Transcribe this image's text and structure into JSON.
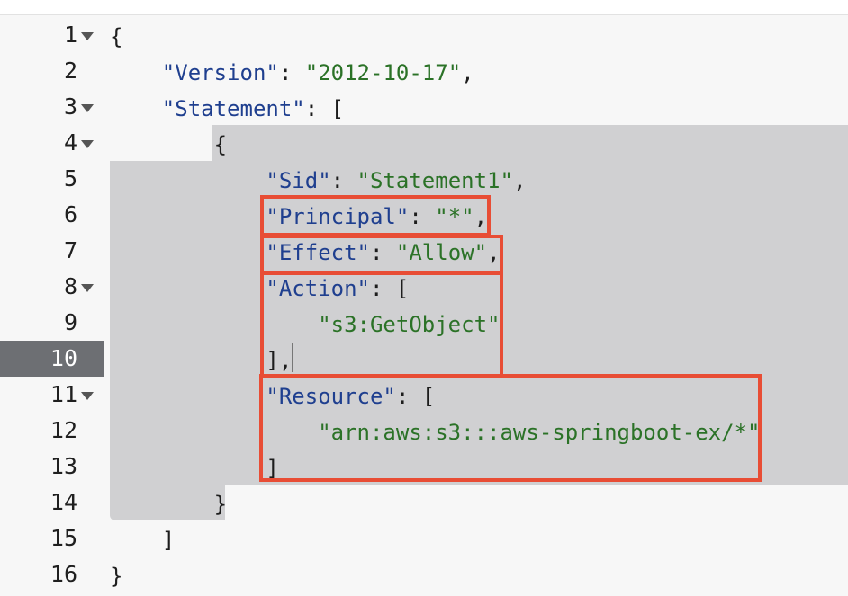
{
  "editor": {
    "active_line": "10",
    "lines": [
      {
        "number": "1",
        "foldable": true,
        "indent": "",
        "parts": {
          "p1": "{"
        }
      },
      {
        "number": "2",
        "foldable": false,
        "indent": "    ",
        "parts": {
          "k": "\"Version\"",
          "p1": ": ",
          "s": "\"2012-10-17\"",
          "p2": ","
        }
      },
      {
        "number": "3",
        "foldable": true,
        "indent": "    ",
        "parts": {
          "k": "\"Statement\"",
          "p1": ": ["
        }
      },
      {
        "number": "4",
        "foldable": true,
        "indent": "        ",
        "parts": {
          "p1": "{"
        }
      },
      {
        "number": "5",
        "foldable": false,
        "indent": "            ",
        "parts": {
          "k": "\"Sid\"",
          "p1": ": ",
          "s": "\"Statement1\"",
          "p2": ","
        }
      },
      {
        "number": "6",
        "foldable": false,
        "indent": "            ",
        "parts": {
          "k": "\"Principal\"",
          "p1": ": ",
          "s": "\"*\"",
          "p2": ","
        }
      },
      {
        "number": "7",
        "foldable": false,
        "indent": "            ",
        "parts": {
          "k": "\"Effect\"",
          "p1": ": ",
          "s": "\"Allow\"",
          "p2": ","
        }
      },
      {
        "number": "8",
        "foldable": true,
        "indent": "            ",
        "parts": {
          "k": "\"Action\"",
          "p1": ": ["
        }
      },
      {
        "number": "9",
        "foldable": false,
        "indent": "                ",
        "parts": {
          "s": "\"s3:GetObject\""
        }
      },
      {
        "number": "10",
        "foldable": false,
        "indent": "            ",
        "parts": {
          "p1": "],"
        }
      },
      {
        "number": "11",
        "foldable": true,
        "indent": "            ",
        "parts": {
          "k": "\"Resource\"",
          "p1": ": ["
        }
      },
      {
        "number": "12",
        "foldable": false,
        "indent": "                ",
        "parts": {
          "s": "\"arn:aws:s3:::aws-springboot-ex/*\""
        }
      },
      {
        "number": "13",
        "foldable": false,
        "indent": "            ",
        "parts": {
          "p1": "]"
        }
      },
      {
        "number": "14",
        "foldable": false,
        "indent": "        ",
        "parts": {
          "p1": "}"
        }
      },
      {
        "number": "15",
        "foldable": false,
        "indent": "    ",
        "parts": {
          "p1": "]"
        }
      },
      {
        "number": "16",
        "foldable": false,
        "indent": "",
        "parts": {
          "p1": "}"
        }
      }
    ]
  },
  "colors": {
    "key": "#1f3f8f",
    "string": "#2b7227",
    "selection": "#d0d0d2",
    "highlight": "#e84d35",
    "active_gutter": "#6d6f73"
  },
  "icons": {
    "fold": "fold-caret-down-icon"
  }
}
